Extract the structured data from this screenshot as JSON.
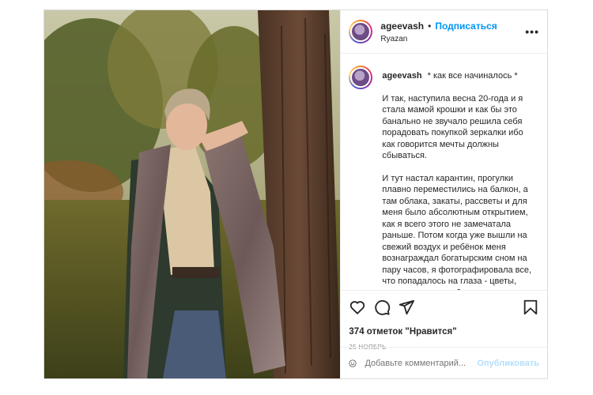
{
  "header": {
    "username": "ageevash",
    "separator": "•",
    "follow_label": "Подписаться",
    "location": "Ryazan",
    "more_label": "•••"
  },
  "caption": {
    "username": "ageevash",
    "title": "* как все начиналось *",
    "paragraphs": [
      "И так, наступила весна 20-года и я стала мамой крошки и как бы это банально не звучало решила себя порадовать покупкой зеркалки ибо как говорится мечты должны сбываться.",
      "И тут настал карантин, прогулки плавно переместились на балкон, а там облака, закаты, рассветы и для меня было абсолютным открытием, как я всего этого не замечатала раньше. Потом когда уже вышли на свежий воздух и ребёнок меня вознаграждал богатырским сном на пару часов, я фотографировала все, что попадалось на глаза - цветы, дома, деревья, небо..."
    ]
  },
  "actions": {
    "icons": [
      "heart-icon",
      "comment-icon",
      "share-icon",
      "bookmark-icon"
    ],
    "likes": "374 отметок \"Нравится\"",
    "date": "25 НОЯБРЬ"
  },
  "comment": {
    "emoji_icon": "smiley-icon",
    "placeholder": "Добавьте комментарий...",
    "publish_label": "Опубликовать"
  },
  "colors": {
    "accent": "#0095f6",
    "publish_disabled": "#b2dffc",
    "muted": "#8e8e8e",
    "border": "#dbdbdb"
  }
}
